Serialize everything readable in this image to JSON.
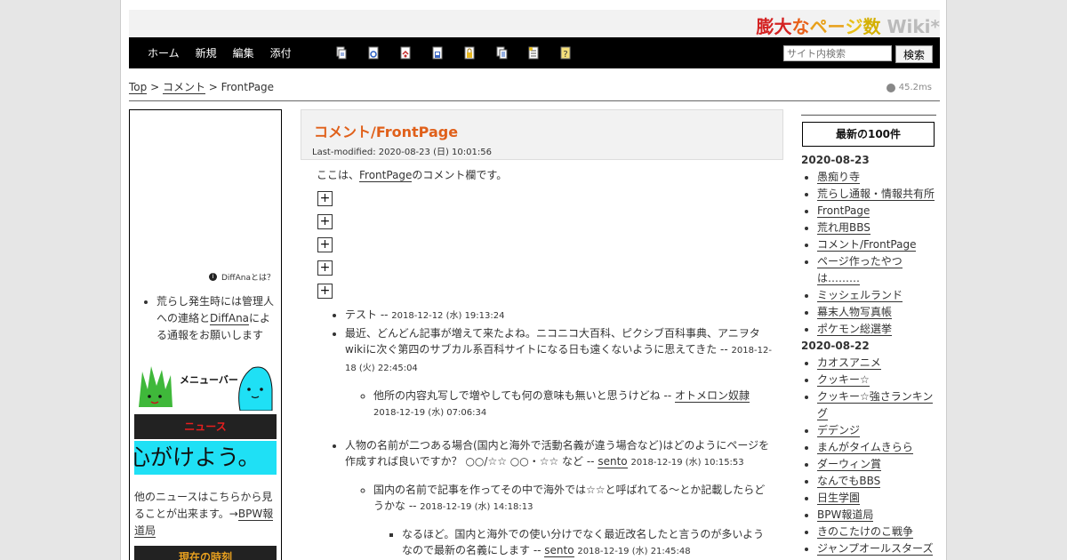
{
  "header": {
    "title_parts": [
      {
        "text": "膨大",
        "color": "#d42222"
      },
      {
        "text": "な",
        "color": "#e8601a"
      },
      {
        "text": "ペー",
        "color": "#e8a01a"
      },
      {
        "text": "ジ",
        "color": "#e8c01a"
      },
      {
        "text": "数",
        "color": "#d4b000"
      },
      {
        "text": " Wiki*",
        "color": "#bbbbbb"
      }
    ]
  },
  "nav": {
    "items": [
      "ホーム",
      "新規",
      "編集",
      "添付"
    ],
    "tool_icons": [
      "copy-icon",
      "diff-icon",
      "backup-icon",
      "save-icon",
      "lock-icon",
      "pagelist-icon",
      "newpage-icon",
      "help-icon"
    ],
    "search_placeholder": "サイト内検索",
    "search_button": "検索"
  },
  "breadcrumb": {
    "top": "Top",
    "sep1": " > ",
    "comment": "コメント",
    "sep2": " > ",
    "current": "FrontPage"
  },
  "timer": "45.2ms",
  "left": {
    "diffana_label": "DiffAnaとは？",
    "note_before": "荒らし発生時には管理人への連絡と",
    "note_link": "DiffAna",
    "note_after": "による通報をお願いします",
    "menubar_label": "メニューバー",
    "news_heading": "ニュース",
    "news_ticker": "心がけよう。",
    "news_more_before": "他のニュースはこちらから見ることが出来ます。→",
    "news_more_link": "BPW報道局",
    "clock_heading": "現在の時刻"
  },
  "main": {
    "title": "コメント/FrontPage",
    "lastmod": "Last-modified: 2020-08-23 (日) 10:01:56",
    "intro_before": "ここは、",
    "intro_link": "FrontPage",
    "intro_after": "のコメント欄です。",
    "expanders": [
      "+",
      "+",
      "+",
      "+",
      "+"
    ],
    "comments": {
      "c1_text": "テスト -- ",
      "c1_ts": "2018-12-12 (水) 19:13:24",
      "c2_text": "最近、どんどん記事が増えて来たよね。ニコニコ大百科、ピクシブ百科事典、アニヲタwikiに次ぐ第四のサブカル系百科サイトになる日も遠くないように思えてきた -- ",
      "c2_ts": "2018-12-18 (火) 22:45:04",
      "c2r_text": "他所の内容丸写しで増やしても何の意味も無いと思うけどね -- ",
      "c2r_author": "オトメロン奴隷",
      "c2r_ts": "2018-12-19 (水) 07:06:34",
      "c3_text": "人物の名前が二つある場合(国内と海外で活動名義が違う場合など)はどのようにページを作成すれば良いですか？ ○○/☆☆ ○○・☆☆ など -- ",
      "c3_author": "sento",
      "c3_ts": "2018-12-19 (水) 10:15:53",
      "c3r_text": "国内の名前で記事を作ってその中で海外では☆☆と呼ばれてる～とか記載したらどうかな -- ",
      "c3r_ts": "2018-12-19 (水) 14:18:13",
      "c3rr_text": "なるほど。国内と海外での使い分けでなく最近改名したと言うのが多いようなので最新の名義にします -- ",
      "c3rr_author": "sento",
      "c3rr_ts": "2018-12-19 (水) 21:45:48"
    }
  },
  "right": {
    "heading": "最新の100件",
    "groups": [
      {
        "date": "2020-08-23",
        "items": [
          "愚痴り寺",
          "荒らし通報・情報共有所",
          "FrontPage",
          "荒れ用BBS",
          "コメント/FrontPage",
          "ページ作ったやつは………",
          "ミッシェルランド",
          "幕末人物写真帳",
          "ポケモン総選挙"
        ]
      },
      {
        "date": "2020-08-22",
        "items": [
          "カオスアニメ",
          "クッキー☆",
          "クッキー☆強さランキング",
          "デデンジ",
          "まんがタイムきらら",
          "ダーウィン賞",
          "なんでもBBS",
          "日生学園",
          "BPW報道局",
          "きのこたけのこ戦争",
          "ジャンプオールスターズ"
        ]
      }
    ]
  }
}
